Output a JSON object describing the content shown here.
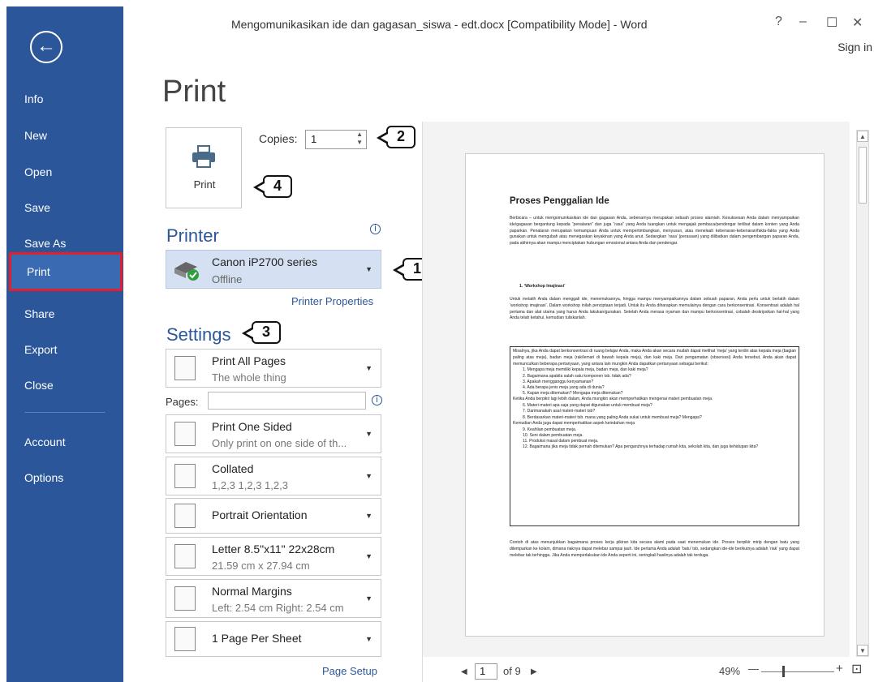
{
  "window": {
    "title": "Mengomunikasikan ide dan gagasan_siswa - edt.docx [Compatibility Mode] - Word",
    "help": "?",
    "minimize": "–",
    "maximize": "☐",
    "close": "✕",
    "sign_in": "Sign in"
  },
  "sidebar": {
    "back_icon": "←",
    "items": [
      {
        "label": "Info"
      },
      {
        "label": "New"
      },
      {
        "label": "Open"
      },
      {
        "label": "Save"
      },
      {
        "label": "Save As"
      },
      {
        "label": "Print"
      },
      {
        "label": "Share"
      },
      {
        "label": "Export"
      },
      {
        "label": "Close"
      },
      {
        "label": "Account"
      },
      {
        "label": "Options"
      }
    ],
    "active": "Print"
  },
  "print": {
    "heading": "Print",
    "button_label": "Print",
    "copies_label": "Copies:",
    "copies_value": "1"
  },
  "printer": {
    "heading": "Printer",
    "name": "Canon iP2700 series",
    "status": "Offline",
    "properties_link": "Printer Properties"
  },
  "settings": {
    "heading": "Settings",
    "pages_label": "Pages:",
    "pages_value": "",
    "items": [
      {
        "l1": "Print All Pages",
        "l2": "The whole thing"
      },
      {
        "l1": "Print One Sided",
        "l2": "Only print on one side of th..."
      },
      {
        "l1": "Collated",
        "l2": "1,2,3   1,2,3   1,2,3"
      },
      {
        "l1": "Portrait Orientation",
        "l2": ""
      },
      {
        "l1": "Letter 8.5\"x11\" 22x28cm",
        "l2": "21.59 cm x 27.94 cm"
      },
      {
        "l1": "Normal Margins",
        "l2": "Left:  2.54 cm   Right:  2.54 cm"
      },
      {
        "l1": "1 Page Per Sheet",
        "l2": ""
      }
    ],
    "page_setup_link": "Page Setup"
  },
  "callouts": {
    "c1": "1",
    "c2": "2",
    "c3": "3",
    "c4": "4"
  },
  "preview": {
    "title": "Proses Penggalian Ide",
    "p1": "Berbicara – untuk mengomunikasikan ide dan gagasan Anda, sebenarnya merupakan sebuah proses alamiah. Kesuksesan Anda dalam menyampaikan ide/gagasan bergantung kepada “penalaran” dan juga “rasa” yang Anda tuangkan untuk mengajak pembaca/pendengar terlibat dalam konten yang Anda paparkan. Penalaran merupakan kemampuan Anda untuk mempertimbangkan, menyusun, atau menelaah kebenaran-kebenaran/fakta-fakta yang Anda gunakan untuk mengubah atau menegaskan keyakinan yang Anda anut. Sedangkan ‘rasa’ (perasaan) yang dilibatkan dalam pengembangan paparan Anda, pada akhirnya akan mampu menciptakan hubungan emosional antara Anda dan pendengar.",
    "sub": "1.   ‘Workshop Imajinasi’",
    "p2": "Untuk melatih Anda dalam menggali ide, menemukannya, hingga mampu menyampaikannya dalam sebuah paparan, Anda perlu untuk berlatih dalam ‘workshop imajinasi’. Dalam workshop inilah penciptaan terjadi. Untuk itu Anda diharapkan memulainya dengan cara berkonsentrasi. Konsentrasi adalah hal pertama dan alat utama yang harus Anda lakukan/gunakan. Setelah Anda merasa nyaman dan mampu berkonsentrasi, cobalah deskripsikan hal-hal yang Anda telah ketahui, kemudian tuliskanlah.",
    "box_p1": "Misalnya, jika Anda dapat berkonsentrasi di ruang belajar Anda, maka Anda akan secara mudah dapat melihat ‘meja’ yang terdiri atas kepala meja (bagian paling atas meja), badan meja (rak/lemari di bawah kepala meja), dan kaki meja. Dari pengamatan (observasi) Anda tersebut, Anda akan dapat memunculkan beberapa pertanyaan, yang antara lain mungkin Anda dapatkan pertanyaan sebagai berikut:",
    "list1": [
      "1.   Mengapa meja memiliki kepala meja, badan meja, dan kaki meja?",
      "2.   Bagaimana apabila salah satu komponen tsb. tidak ada?",
      "3.   Apakah mengganggu kenyamanan?",
      "4.   Ada berapa jenis meja yang ada di dunia?",
      "5.   Kapan meja ditemukan? Mengapa meja ditemukan?"
    ],
    "box_p2": "Ketika Anda berpikir lagi lebih dalam, Anda mungkin akan memperhatikan mengenai materi pembuatan meja.",
    "list2": [
      "6.   Materi-materi apa saja yang dapat digunakan untuk membuat meja?",
      "7.   Darimanakah asal materi-materi tsb?",
      "8.   Berdasarkan materi-materi tsb. mana yang paling Anda sukai untuk membuat meja? Mengapa?"
    ],
    "box_p3": "Kemudian Anda juga dapat memperhatikan aspek keindahan meja",
    "list3": [
      "9.   Keahlian pembuatan meja.",
      "10.  Seni dalam pembuatan meja.",
      "11.  Produksi masal dalam pembuat meja.",
      "12.  Bagaimana jika meja tidak pernah ditemukan? Apa pengaruhnya terhadap rumah kita, sekolah kita, dan juga kehidupan kita?"
    ],
    "p3": "Contoh di atas menunjukkan bagaimana proses kerja pikiran kita secara alami pada saat menemukan ide. Proses berpikir mirip dengan batu yang dilemparkan ke kolam, dimana riaknya dapat melebar sampai jauh. Ide pertama Anda adalah ‘batu’ tsb, sedangkan ide-ide berikutnya adalah ‘riak’ yang dapat melebar tak terhingga. Jika Anda memperlakukan ide Anda seperti ini, seringkali hasilnya adalah tak terduga."
  },
  "footer": {
    "prev": "◀",
    "page_value": "1",
    "of_pages": "of 9",
    "next": "▶",
    "zoom": "49%",
    "zoom_out": "—",
    "zoom_in": "+",
    "zoom_page_icon": "⊡"
  }
}
